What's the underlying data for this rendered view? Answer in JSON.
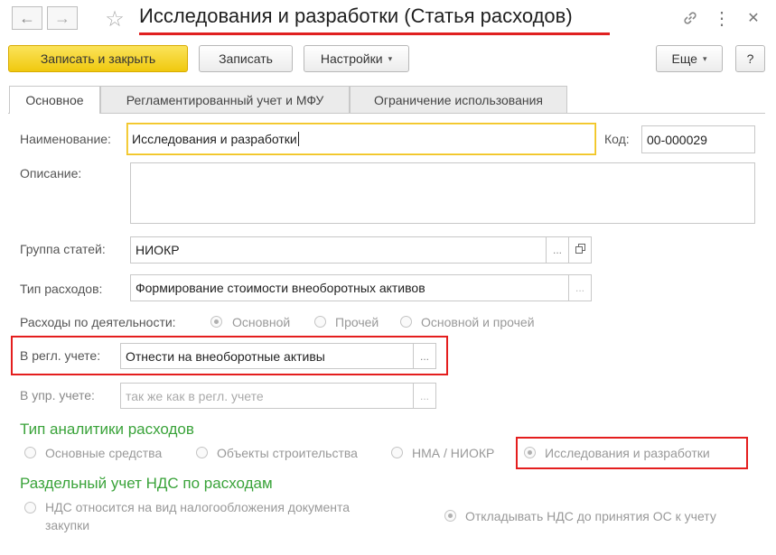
{
  "header": {
    "title": "Исследования и разработки (Статья расходов)",
    "back_icon": "arrow-left-icon",
    "forward_icon": "arrow-right-icon",
    "favorite_icon": "star-icon",
    "link_icon": "link-icon",
    "more_icon": "more-vertical-icon",
    "close_icon": "close-icon"
  },
  "toolbar": {
    "save_close_label": "Записать и закрыть",
    "save_label": "Записать",
    "settings_label": "Настройки",
    "more_label": "Еще",
    "help_label": "?"
  },
  "tabs": [
    {
      "label": "Основное"
    },
    {
      "label": "Регламентированный учет и МФУ"
    },
    {
      "label": "Ограничение использования"
    }
  ],
  "form": {
    "name_label": "Наименование:",
    "name_value": "Исследования и разработки",
    "code_label": "Код:",
    "code_value": "00-000029",
    "description_label": "Описание:",
    "description_value": "",
    "group_label": "Группа статей:",
    "group_value": "НИОКР",
    "type_label": "Тип расходов:",
    "type_value": "Формирование стоимости внеоборотных активов",
    "activity_label": "Расходы по деятельности:",
    "activity_options": [
      "Основной",
      "Прочей",
      "Основной и прочей"
    ],
    "regl_label": "В регл. учете:",
    "regl_value": "Отнести на внеоборотные активы",
    "upr_label": "В упр. учете:",
    "upr_placeholder": "так же как в регл. учете",
    "select_button": "...",
    "open_icon": "open-window-icon"
  },
  "analytics": {
    "heading": "Тип аналитики расходов",
    "options": [
      "Основные средства",
      "Объекты строительства",
      "НМА / НИОКР",
      "Исследования и разработки"
    ]
  },
  "vat": {
    "heading": "Раздельный учет НДС по расходам",
    "option1_line1": "НДС относится на вид налогообложения документа",
    "option1_line2": "закупки",
    "option2": "Откладывать НДС до принятия ОС к учету"
  },
  "colors": {
    "primary_button": "#f5d327",
    "section_heading": "#3aa33a",
    "highlight_box": "#e41e1e",
    "title_underline": "#e02020"
  }
}
